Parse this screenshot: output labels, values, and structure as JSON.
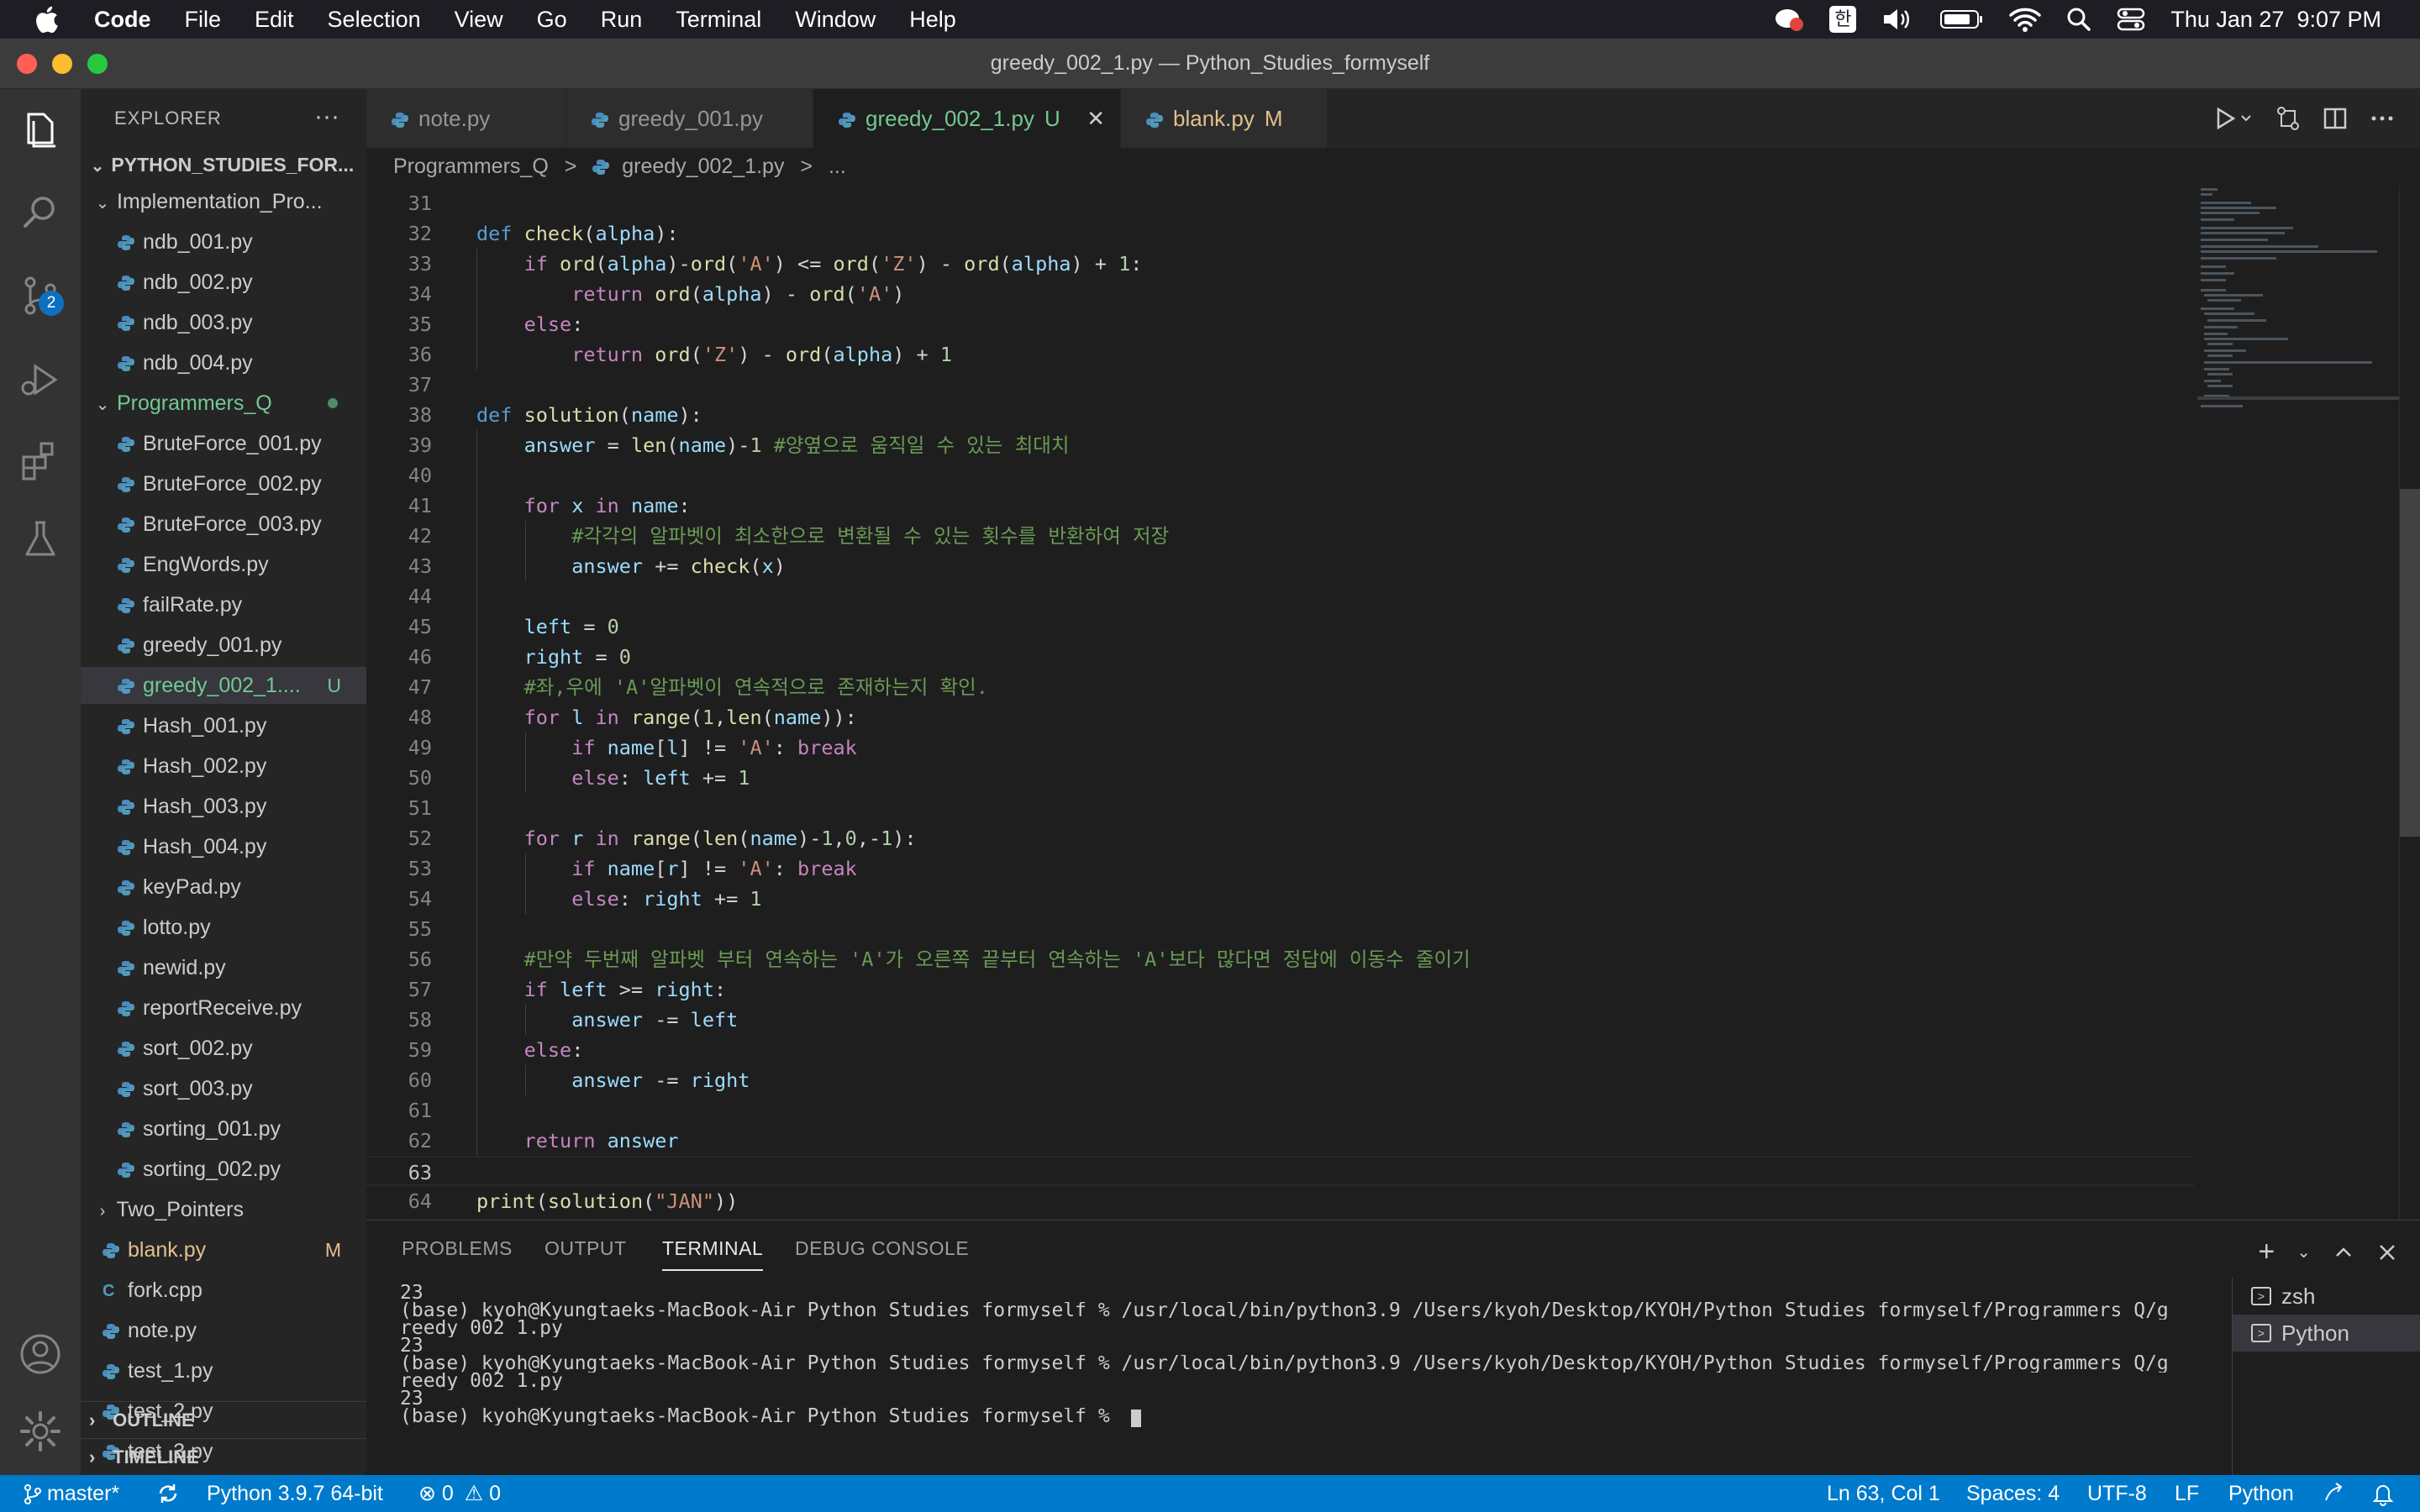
{
  "menubar": {
    "app": "Code",
    "items": [
      "File",
      "Edit",
      "Selection",
      "View",
      "Go",
      "Run",
      "Terminal",
      "Window",
      "Help"
    ],
    "input_method": "한",
    "datetime": "Thu Jan 27  9:07 PM"
  },
  "window": {
    "title": "greedy_002_1.py — Python_Studies_formyself"
  },
  "activity": {
    "source_control_badge": "2"
  },
  "sidebar": {
    "title": "EXPLORER",
    "more": "···",
    "root": "PYTHON_STUDIES_FOR...",
    "tree": [
      {
        "label": "Implementation_Pro...",
        "type": "folder",
        "open": true,
        "depth": 1
      },
      {
        "label": "ndb_001.py",
        "type": "py",
        "depth": 2
      },
      {
        "label": "ndb_002.py",
        "type": "py",
        "depth": 2
      },
      {
        "label": "ndb_003.py",
        "type": "py",
        "depth": 2
      },
      {
        "label": "ndb_004.py",
        "type": "py",
        "depth": 2
      },
      {
        "label": "Programmers_Q",
        "type": "folder",
        "open": true,
        "depth": 1,
        "modified": true
      },
      {
        "label": "BruteForce_001.py",
        "type": "py",
        "depth": 2
      },
      {
        "label": "BruteForce_002.py",
        "type": "py",
        "depth": 2
      },
      {
        "label": "BruteForce_003.py",
        "type": "py",
        "depth": 2
      },
      {
        "label": "EngWords.py",
        "type": "py",
        "depth": 2
      },
      {
        "label": "failRate.py",
        "type": "py",
        "depth": 2
      },
      {
        "label": "greedy_001.py",
        "type": "py",
        "depth": 2
      },
      {
        "label": "greedy_002_1....",
        "type": "py",
        "depth": 2,
        "status": "U",
        "selected": true
      },
      {
        "label": "Hash_001.py",
        "type": "py",
        "depth": 2
      },
      {
        "label": "Hash_002.py",
        "type": "py",
        "depth": 2
      },
      {
        "label": "Hash_003.py",
        "type": "py",
        "depth": 2
      },
      {
        "label": "Hash_004.py",
        "type": "py",
        "depth": 2
      },
      {
        "label": "keyPad.py",
        "type": "py",
        "depth": 2
      },
      {
        "label": "lotto.py",
        "type": "py",
        "depth": 2
      },
      {
        "label": "newid.py",
        "type": "py",
        "depth": 2
      },
      {
        "label": "reportReceive.py",
        "type": "py",
        "depth": 2
      },
      {
        "label": "sort_002.py",
        "type": "py",
        "depth": 2
      },
      {
        "label": "sort_003.py",
        "type": "py",
        "depth": 2
      },
      {
        "label": "sorting_001.py",
        "type": "py",
        "depth": 2
      },
      {
        "label": "sorting_002.py",
        "type": "py",
        "depth": 2
      },
      {
        "label": "Two_Pointers",
        "type": "folder",
        "open": false,
        "depth": 1
      },
      {
        "label": "blank.py",
        "type": "py",
        "depth": 1,
        "status": "M"
      },
      {
        "label": "fork.cpp",
        "type": "cpp",
        "depth": 1
      },
      {
        "label": "note.py",
        "type": "py",
        "depth": 1
      },
      {
        "label": "test_1.py",
        "type": "py",
        "depth": 1
      },
      {
        "label": "test_2.py",
        "type": "py",
        "depth": 1
      },
      {
        "label": "test_3.py",
        "type": "py",
        "depth": 1
      }
    ],
    "sections": [
      "OUTLINE",
      "TIMELINE"
    ]
  },
  "tabs": [
    {
      "label": "note.py",
      "status": "",
      "active": false
    },
    {
      "label": "greedy_001.py",
      "status": "",
      "active": false
    },
    {
      "label": "greedy_002_1.py",
      "status": "U",
      "active": true,
      "close": "✕"
    },
    {
      "label": "blank.py",
      "status": "M",
      "active": false
    }
  ],
  "breadcrumb": {
    "folder": "Programmers_Q",
    "sep": ">",
    "file": "greedy_002_1.py",
    "tail": "..."
  },
  "editor": {
    "current_line": 63,
    "lines": [
      {
        "n": 31,
        "t": []
      },
      {
        "n": 32,
        "t": [
          [
            "kw",
            "def "
          ],
          [
            "fn",
            "check"
          ],
          [
            "p",
            "("
          ],
          [
            "var",
            "alpha"
          ],
          [
            "p",
            "):"
          ]
        ]
      },
      {
        "n": 33,
        "t": [
          [
            "p",
            "    "
          ],
          [
            "ctl",
            "if "
          ],
          [
            "fn",
            "ord"
          ],
          [
            "p",
            "("
          ],
          [
            "var",
            "alpha"
          ],
          [
            "p",
            ")-"
          ],
          [
            "fn",
            "ord"
          ],
          [
            "p",
            "("
          ],
          [
            "str",
            "'A'"
          ],
          [
            "p",
            ") <= "
          ],
          [
            "fn",
            "ord"
          ],
          [
            "p",
            "("
          ],
          [
            "str",
            "'Z'"
          ],
          [
            "p",
            ") - "
          ],
          [
            "fn",
            "ord"
          ],
          [
            "p",
            "("
          ],
          [
            "var",
            "alpha"
          ],
          [
            "p",
            ") + "
          ],
          [
            "num",
            "1"
          ],
          [
            "p",
            ":"
          ]
        ]
      },
      {
        "n": 34,
        "t": [
          [
            "p",
            "        "
          ],
          [
            "ctl",
            "return "
          ],
          [
            "fn",
            "ord"
          ],
          [
            "p",
            "("
          ],
          [
            "var",
            "alpha"
          ],
          [
            "p",
            ") - "
          ],
          [
            "fn",
            "ord"
          ],
          [
            "p",
            "("
          ],
          [
            "str",
            "'A'"
          ],
          [
            "p",
            ")"
          ]
        ]
      },
      {
        "n": 35,
        "t": [
          [
            "p",
            "    "
          ],
          [
            "ctl",
            "else"
          ],
          [
            "p",
            ":"
          ]
        ]
      },
      {
        "n": 36,
        "t": [
          [
            "p",
            "        "
          ],
          [
            "ctl",
            "return "
          ],
          [
            "fn",
            "ord"
          ],
          [
            "p",
            "("
          ],
          [
            "str",
            "'Z'"
          ],
          [
            "p",
            ") - "
          ],
          [
            "fn",
            "ord"
          ],
          [
            "p",
            "("
          ],
          [
            "var",
            "alpha"
          ],
          [
            "p",
            ") + "
          ],
          [
            "num",
            "1"
          ]
        ]
      },
      {
        "n": 37,
        "t": []
      },
      {
        "n": 38,
        "t": [
          [
            "kw",
            "def "
          ],
          [
            "fn",
            "solution"
          ],
          [
            "p",
            "("
          ],
          [
            "var",
            "name"
          ],
          [
            "p",
            "):"
          ]
        ]
      },
      {
        "n": 39,
        "t": [
          [
            "p",
            "    "
          ],
          [
            "var",
            "answer"
          ],
          [
            "p",
            " = "
          ],
          [
            "fn",
            "len"
          ],
          [
            "p",
            "("
          ],
          [
            "var",
            "name"
          ],
          [
            "p",
            ")-"
          ],
          [
            "num",
            "1"
          ],
          [
            "p",
            " "
          ],
          [
            "cmt",
            "#양옆으로 움직일 수 있는 최대치"
          ]
        ]
      },
      {
        "n": 40,
        "t": []
      },
      {
        "n": 41,
        "t": [
          [
            "p",
            "    "
          ],
          [
            "ctl",
            "for "
          ],
          [
            "var",
            "x"
          ],
          [
            "ctl",
            " in "
          ],
          [
            "var",
            "name"
          ],
          [
            "p",
            ":"
          ]
        ]
      },
      {
        "n": 42,
        "t": [
          [
            "p",
            "        "
          ],
          [
            "cmt",
            "#각각의 알파벳이 최소한으로 변환될 수 있는 횟수를 반환하여 저장"
          ]
        ]
      },
      {
        "n": 43,
        "t": [
          [
            "p",
            "        "
          ],
          [
            "var",
            "answer"
          ],
          [
            "p",
            " += "
          ],
          [
            "fn",
            "check"
          ],
          [
            "p",
            "("
          ],
          [
            "var",
            "x"
          ],
          [
            "p",
            ")"
          ]
        ]
      },
      {
        "n": 44,
        "t": []
      },
      {
        "n": 45,
        "t": [
          [
            "p",
            "    "
          ],
          [
            "var",
            "left"
          ],
          [
            "p",
            " = "
          ],
          [
            "num",
            "0"
          ]
        ]
      },
      {
        "n": 46,
        "t": [
          [
            "p",
            "    "
          ],
          [
            "var",
            "right"
          ],
          [
            "p",
            " = "
          ],
          [
            "num",
            "0"
          ]
        ]
      },
      {
        "n": 47,
        "t": [
          [
            "p",
            "    "
          ],
          [
            "cmt",
            "#좌,우에 'A'알파벳이 연속적으로 존재하는지 확인."
          ]
        ]
      },
      {
        "n": 48,
        "t": [
          [
            "p",
            "    "
          ],
          [
            "ctl",
            "for "
          ],
          [
            "var",
            "l"
          ],
          [
            "ctl",
            " in "
          ],
          [
            "fn",
            "range"
          ],
          [
            "p",
            "("
          ],
          [
            "num",
            "1"
          ],
          [
            "p",
            ","
          ],
          [
            "fn",
            "len"
          ],
          [
            "p",
            "("
          ],
          [
            "var",
            "name"
          ],
          [
            "p",
            "))"
          ],
          [
            "p",
            ":"
          ]
        ]
      },
      {
        "n": 49,
        "t": [
          [
            "p",
            "        "
          ],
          [
            "ctl",
            "if "
          ],
          [
            "var",
            "name"
          ],
          [
            "p",
            "["
          ],
          [
            "var",
            "l"
          ],
          [
            "p",
            "] != "
          ],
          [
            "str",
            "'A'"
          ],
          [
            "p",
            ": "
          ],
          [
            "ctl",
            "break"
          ]
        ]
      },
      {
        "n": 50,
        "t": [
          [
            "p",
            "        "
          ],
          [
            "ctl",
            "else"
          ],
          [
            "p",
            ": "
          ],
          [
            "var",
            "left"
          ],
          [
            "p",
            " += "
          ],
          [
            "num",
            "1"
          ]
        ]
      },
      {
        "n": 51,
        "t": []
      },
      {
        "n": 52,
        "t": [
          [
            "p",
            "    "
          ],
          [
            "ctl",
            "for "
          ],
          [
            "var",
            "r"
          ],
          [
            "ctl",
            " in "
          ],
          [
            "fn",
            "range"
          ],
          [
            "p",
            "("
          ],
          [
            "fn",
            "len"
          ],
          [
            "p",
            "("
          ],
          [
            "var",
            "name"
          ],
          [
            "p",
            ")-"
          ],
          [
            "num",
            "1"
          ],
          [
            "p",
            ","
          ],
          [
            "num",
            "0"
          ],
          [
            "p",
            ",-"
          ],
          [
            "num",
            "1"
          ],
          [
            "p",
            "):"
          ]
        ]
      },
      {
        "n": 53,
        "t": [
          [
            "p",
            "        "
          ],
          [
            "ctl",
            "if "
          ],
          [
            "var",
            "name"
          ],
          [
            "p",
            "["
          ],
          [
            "var",
            "r"
          ],
          [
            "p",
            "] != "
          ],
          [
            "str",
            "'A'"
          ],
          [
            "p",
            ": "
          ],
          [
            "ctl",
            "break"
          ]
        ]
      },
      {
        "n": 54,
        "t": [
          [
            "p",
            "        "
          ],
          [
            "ctl",
            "else"
          ],
          [
            "p",
            ": "
          ],
          [
            "var",
            "right"
          ],
          [
            "p",
            " += "
          ],
          [
            "num",
            "1"
          ]
        ]
      },
      {
        "n": 55,
        "t": []
      },
      {
        "n": 56,
        "t": [
          [
            "p",
            "    "
          ],
          [
            "cmt",
            "#만약 두번째 알파벳 부터 연속하는 'A'가 오른쪽 끝부터 연속하는 'A'보다 많다면 정답에 이동수 줄이기"
          ]
        ]
      },
      {
        "n": 57,
        "t": [
          [
            "p",
            "    "
          ],
          [
            "ctl",
            "if "
          ],
          [
            "var",
            "left"
          ],
          [
            "p",
            " >= "
          ],
          [
            "var",
            "right"
          ],
          [
            "p",
            ":"
          ]
        ]
      },
      {
        "n": 58,
        "t": [
          [
            "p",
            "        "
          ],
          [
            "var",
            "answer"
          ],
          [
            "p",
            " -= "
          ],
          [
            "var",
            "left"
          ]
        ]
      },
      {
        "n": 59,
        "t": [
          [
            "p",
            "    "
          ],
          [
            "ctl",
            "else"
          ],
          [
            "p",
            ":"
          ]
        ]
      },
      {
        "n": 60,
        "t": [
          [
            "p",
            "        "
          ],
          [
            "var",
            "answer"
          ],
          [
            "p",
            " -= "
          ],
          [
            "var",
            "right"
          ]
        ]
      },
      {
        "n": 61,
        "t": []
      },
      {
        "n": 62,
        "t": [
          [
            "p",
            "    "
          ],
          [
            "ctl",
            "return "
          ],
          [
            "var",
            "answer"
          ]
        ]
      },
      {
        "n": 63,
        "t": []
      },
      {
        "n": 64,
        "t": [
          [
            "fn",
            "print"
          ],
          [
            "p",
            "("
          ],
          [
            "fn",
            "solution"
          ],
          [
            "p",
            "("
          ],
          [
            "str",
            "\"JAN\""
          ],
          [
            "p",
            "))"
          ]
        ]
      }
    ]
  },
  "panel": {
    "tabs": [
      "PROBLEMS",
      "OUTPUT",
      "TERMINAL",
      "DEBUG CONSOLE"
    ],
    "active_tab": "TERMINAL",
    "terminal_lines": [
      "23",
      "(base) kyoh@Kyungtaeks-MacBook-Air Python_Studies_formyself % /usr/local/bin/python3.9 /Users/kyoh/Desktop/KYOH/Python_Studies_formyself/Programmers_Q/g",
      "reedy_002_1.py",
      "23",
      "(base) kyoh@Kyungtaeks-MacBook-Air Python_Studies_formyself % /usr/local/bin/python3.9 /Users/kyoh/Desktop/KYOH/Python_Studies_formyself/Programmers_Q/g",
      "reedy_002_1.py",
      "23",
      "(base) kyoh@Kyungtaeks-MacBook-Air Python_Studies_formyself % "
    ],
    "terminals": [
      {
        "label": "zsh",
        "active": false
      },
      {
        "label": "Python",
        "active": true
      }
    ]
  },
  "statusbar": {
    "branch": "master*",
    "interpreter": "Python 3.9.7 64-bit",
    "errors": "0",
    "warnings": "0",
    "position": "Ln 63, Col 1",
    "spaces": "Spaces: 4",
    "encoding": "UTF-8",
    "eol": "LF",
    "language": "Python"
  },
  "colors": {
    "accent": "#007acc",
    "untracked": "#73c991",
    "modified": "#e2c08d",
    "folder_modified": "#73c991"
  }
}
